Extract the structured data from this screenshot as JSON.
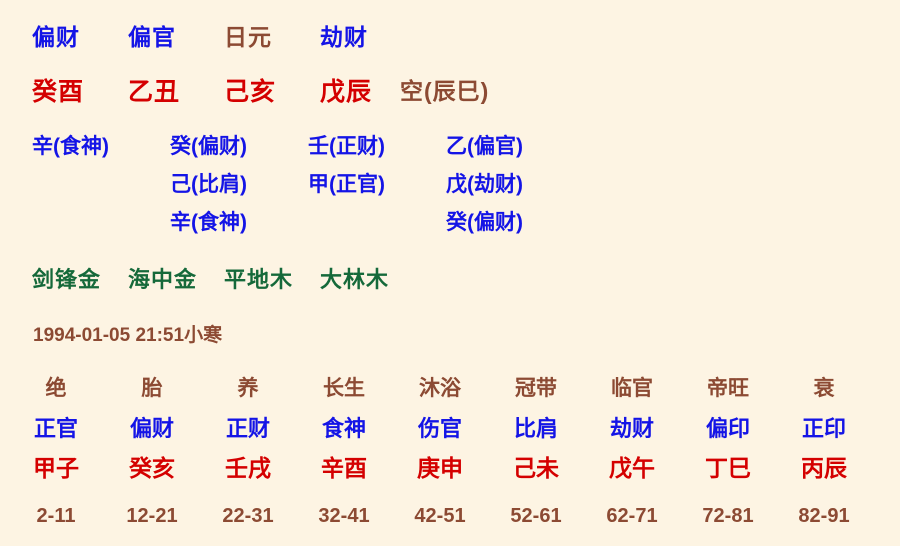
{
  "chart": {
    "type": "bazi-four-pillars",
    "background_color": "#fdf4e3",
    "colors": {
      "ten_god_blue": "#1414e6",
      "ganzhi_red": "#d40000",
      "day_master_brown": "#8c4a33",
      "nayin_green": "#15693a"
    }
  },
  "pillars": {
    "ten_gods": [
      {
        "label": "偏财",
        "color": "blue"
      },
      {
        "label": "偏官",
        "color": "blue"
      },
      {
        "label": "日元",
        "color": "brown"
      },
      {
        "label": "劫财",
        "color": "blue"
      }
    ],
    "ganzhi": [
      "癸酉",
      "乙丑",
      "己亥",
      "戊辰"
    ],
    "kongwang": "空(辰巳)",
    "hidden_stems": {
      "row1": [
        "辛(食神)",
        "癸(偏财)",
        "壬(正财)",
        "乙(偏官)"
      ],
      "row2": [
        "",
        "己(比肩)",
        "甲(正官)",
        "戊(劫财)"
      ],
      "row3": [
        "",
        "辛(食神)",
        "",
        "癸(偏财)"
      ]
    },
    "nayin": [
      "剑锋金",
      "海中金",
      "平地木",
      "大林木"
    ]
  },
  "datetime": {
    "text": "1994-01-05 21:51小寒"
  },
  "luck_pillars": {
    "stages": [
      "绝",
      "胎",
      "养",
      "长生",
      "沐浴",
      "冠带",
      "临官",
      "帝旺",
      "衰"
    ],
    "ten_gods": [
      "正官",
      "偏财",
      "正财",
      "食神",
      "伤官",
      "比肩",
      "劫财",
      "偏印",
      "正印"
    ],
    "ganzhi": [
      "甲子",
      "癸亥",
      "壬戌",
      "辛酉",
      "庚申",
      "己未",
      "戊午",
      "丁巳",
      "丙辰"
    ],
    "age_ranges": [
      "2-11",
      "12-21",
      "22-31",
      "32-41",
      "42-51",
      "52-61",
      "62-71",
      "72-81",
      "82-91"
    ]
  }
}
